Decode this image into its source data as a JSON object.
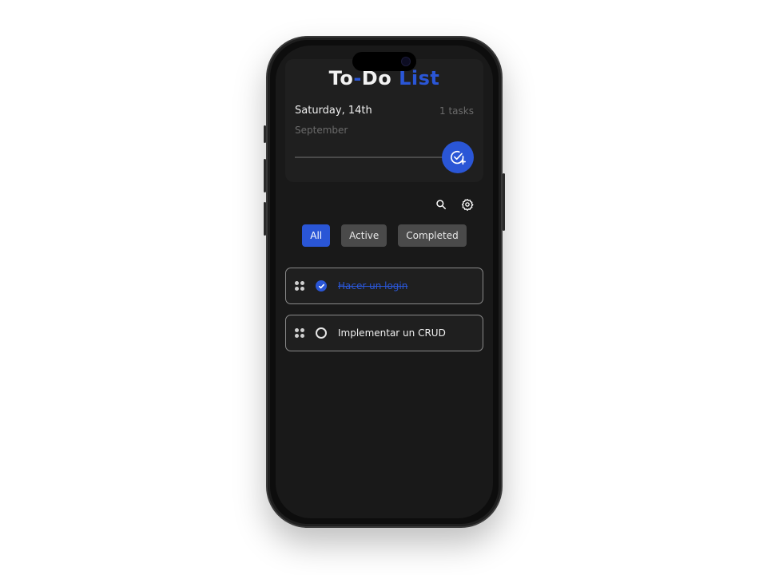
{
  "header": {
    "title_part1": "To",
    "title_sep": "-",
    "title_part2": "Do",
    "title_accent": "List",
    "date": "Saturday, 14th",
    "month": "September",
    "tasks_count": "1 tasks"
  },
  "toolbar": {
    "search_icon": "search-icon",
    "settings_icon": "gear-icon",
    "add_icon": "check-plus-icon"
  },
  "filters": [
    {
      "label": "All",
      "active": true
    },
    {
      "label": "Active",
      "active": false
    },
    {
      "label": "Completed",
      "active": false
    }
  ],
  "todos": [
    {
      "text": "Hacer un login",
      "completed": true
    },
    {
      "text": "Implementar un CRUD",
      "completed": false
    }
  ],
  "colors": {
    "accent": "#2a56d6",
    "background": "#191919",
    "card": "#1f1f1f"
  }
}
